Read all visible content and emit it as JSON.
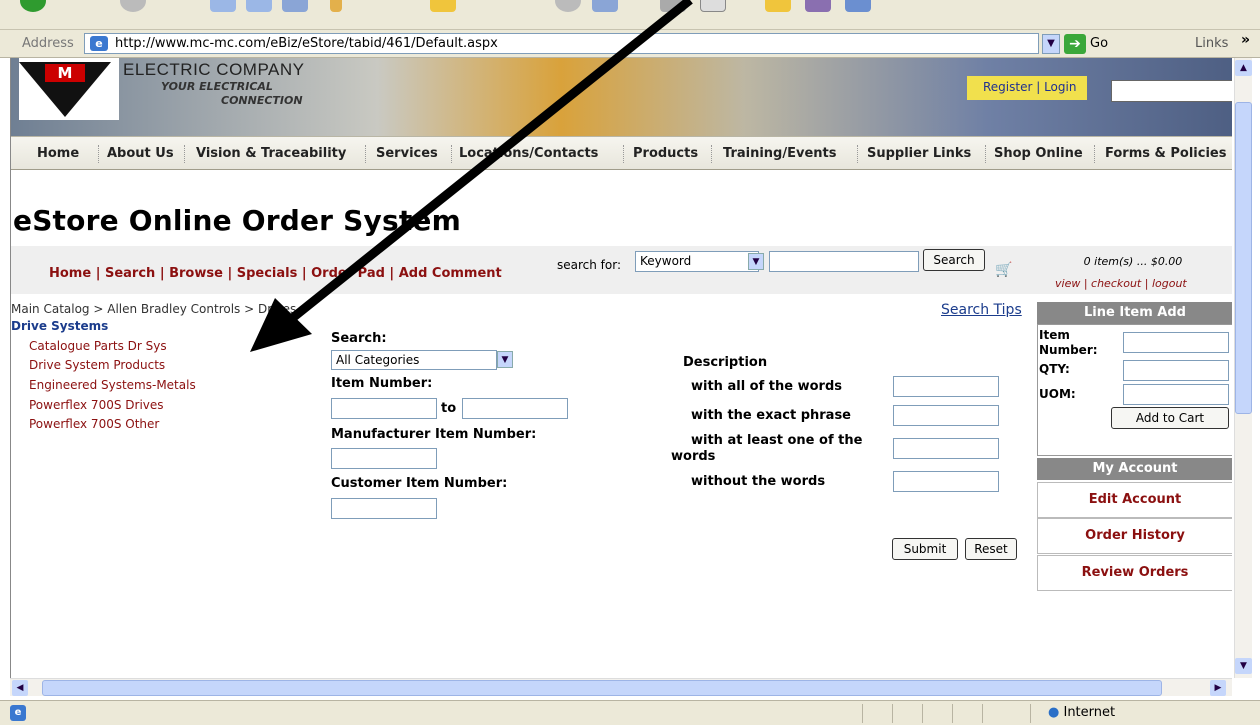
{
  "browser": {
    "address_label": "Address",
    "url": "http://www.mc-mc.com/eBiz/eStore/tabid/461/Default.aspx",
    "go_label": "Go",
    "links_label": "Links",
    "links_more": "»",
    "status_zone": "Internet"
  },
  "header": {
    "company": "ELECTRIC COMPANY",
    "tagline_1": "YOUR ELECTRICAL",
    "tagline_2": "CONNECTION",
    "register_login": "Register  |  Login"
  },
  "nav": {
    "items": [
      "Home",
      "About Us",
      "Vision & Traceability",
      "Services",
      "Locations/Contacts",
      "Products",
      "Training/Events",
      "Supplier Links",
      "Shop Online",
      "Forms & Policies"
    ]
  },
  "page": {
    "title": "eStore Online Order System",
    "store_nav": "Home | Search | Browse | Specials | Order Pad | Add Comment",
    "search_for_label": "search for:",
    "search_type": "Keyword",
    "search_button": "Search",
    "cart_summary": "0 item(s) ... $0.00",
    "cart_links": "view | checkout | logout",
    "breadcrumb": "Main Catalog > Allen Bradley Controls > Drives",
    "category_title": "Drive Systems",
    "categories": [
      "Catalogue Parts Dr Sys",
      "Drive System Products",
      "Engineered Systems-Metals",
      "Powerflex 700S Drives",
      "Powerflex 700S Other"
    ],
    "search_tips": "Search Tips"
  },
  "form": {
    "search_label": "Search:",
    "search_category": "All Categories",
    "item_number_label": "Item Number:",
    "to_label": "to",
    "mfr_item_label": "Manufacturer Item Number:",
    "customer_item_label": "Customer Item Number:",
    "description_label": "Description",
    "all_words_label": "with all of the words",
    "exact_phrase_label": "with the exact phrase",
    "at_least_one_label_1": "with at least one of the",
    "at_least_one_label_2": "words",
    "without_label": "without the words",
    "submit": "Submit",
    "reset": "Reset"
  },
  "line_item_add": {
    "title": "Line Item Add",
    "item_label_1": "Item",
    "item_label_2": "Number:",
    "qty_label": "QTY:",
    "uom_label": "UOM:",
    "add_button": "Add to Cart"
  },
  "my_account": {
    "title": "My Account",
    "items": [
      "Edit Account",
      "Order History",
      "Review Orders"
    ]
  },
  "icons": {
    "ie_page": "ie-page-icon",
    "go": "go-arrow-icon",
    "cart": "shopping-cart-icon",
    "internet": "globe-icon"
  }
}
